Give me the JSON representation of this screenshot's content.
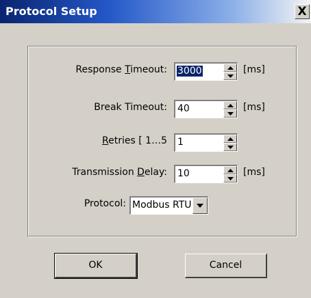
{
  "window": {
    "title": "Protocol Setup",
    "close_glyph": "X"
  },
  "fields": {
    "response_timeout": {
      "label_pre": "Response ",
      "label_u": "T",
      "label_post": "imeout:",
      "value": "3000",
      "unit": "[ms]"
    },
    "break_timeout": {
      "label": "Break Timeout:",
      "value": "40",
      "unit": "[ms]"
    },
    "retries": {
      "label_u": "R",
      "label_post": "etries [ 1…5",
      "value": "1"
    },
    "transmission_delay": {
      "label_pre": "Transmission ",
      "label_u": "D",
      "label_post": "elay:",
      "value": "10",
      "unit": "[ms]"
    },
    "protocol": {
      "label": "Protocol:",
      "value": "Modbus RTU"
    }
  },
  "buttons": {
    "ok": "OK",
    "cancel": "Cancel"
  },
  "icons": {
    "close": "close-icon",
    "spin_up": "arrow-up-icon",
    "spin_down": "arrow-down-icon",
    "dropdown": "chevron-down-icon"
  }
}
